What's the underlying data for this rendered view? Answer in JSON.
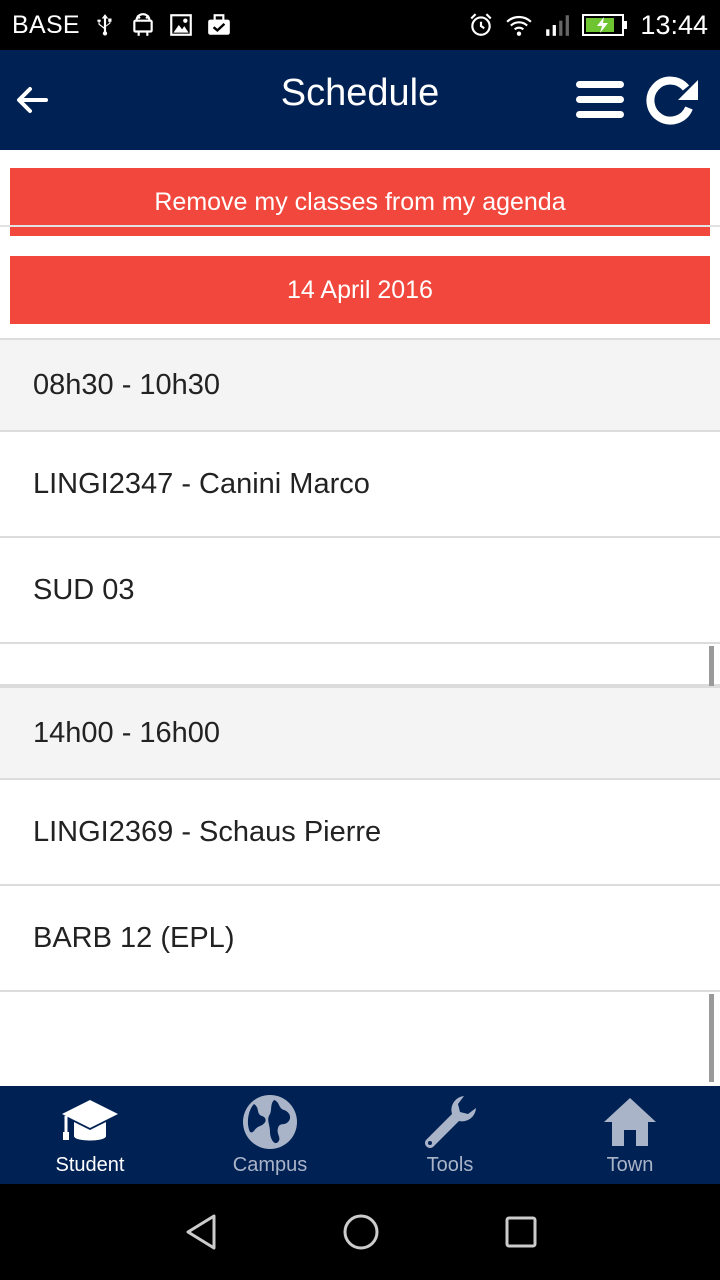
{
  "status_bar": {
    "carrier": "BASE",
    "time": "13:44",
    "left_icons": [
      "usb-icon",
      "android-icon",
      "image-icon",
      "briefcase-check-icon"
    ],
    "right_icons": [
      "alarm-icon",
      "wifi-icon",
      "signal-icon",
      "battery-charging-icon"
    ]
  },
  "app_bar": {
    "title": "Schedule",
    "back_icon": "arrow-back-icon",
    "menu_icon": "hamburger-menu-icon",
    "refresh_icon": "refresh-icon"
  },
  "actions": {
    "remove_label": "Remove my classes from my agenda",
    "date_label": "14 April 2016"
  },
  "schedule": [
    {
      "time": "08h30 - 10h30",
      "course": "LINGI2347 - Canini Marco",
      "room": "SUD 03"
    },
    {
      "time": "14h00 - 16h00",
      "course": "LINGI2369 - Schaus Pierre",
      "room": "BARB 12 (EPL)"
    }
  ],
  "bottom_nav": {
    "items": [
      {
        "label": "Student",
        "icon": "graduation-cap-icon",
        "active": true
      },
      {
        "label": "Campus",
        "icon": "globe-icon",
        "active": false
      },
      {
        "label": "Tools",
        "icon": "wrench-icon",
        "active": false
      },
      {
        "label": "Town",
        "icon": "home-icon",
        "active": false
      }
    ]
  },
  "colors": {
    "app_bar": "#002154",
    "accent_red": "#f2473c",
    "time_row_bg": "#f4f4f4",
    "nav_inactive": "#aab4c8"
  }
}
